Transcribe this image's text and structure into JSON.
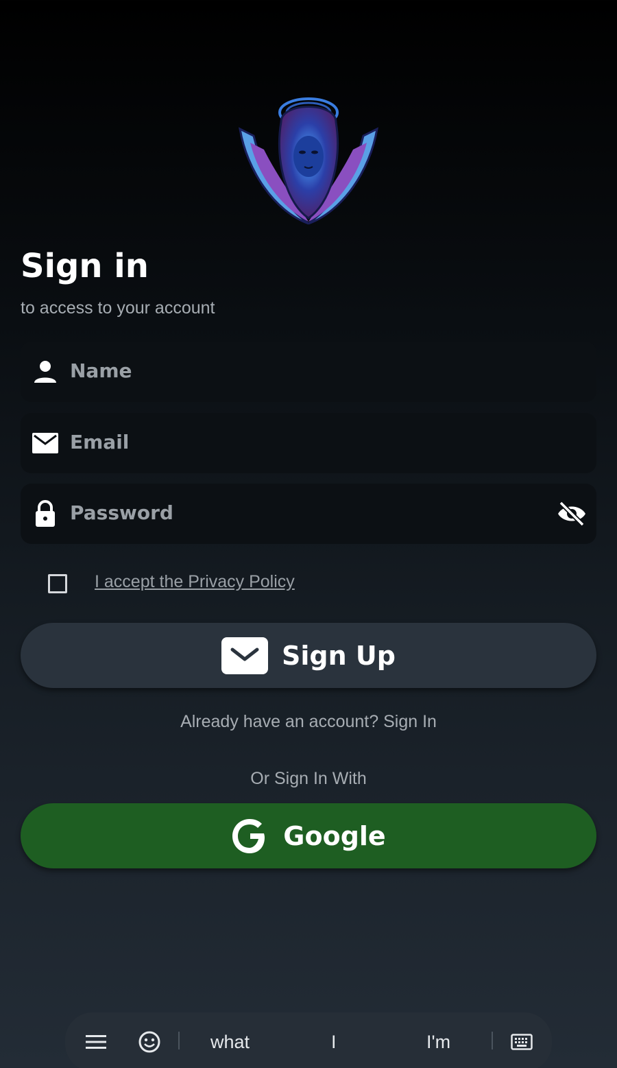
{
  "header": {
    "title": "Sign in",
    "subtitle": "to access to your account"
  },
  "form": {
    "name_placeholder": "Name",
    "email_placeholder": "Email",
    "password_placeholder": "Password",
    "policy_label": "I accept the Privacy Policy",
    "policy_checked": false
  },
  "actions": {
    "signup_label": "Sign Up",
    "already_account": "Already have an account? Sign In",
    "or_sign_in_with": "Or Sign In With",
    "google_label": "Google"
  },
  "keyboard": {
    "suggestions": [
      "what",
      "I",
      "I'm"
    ]
  },
  "icons": {
    "name": "person-icon",
    "email": "mail-icon",
    "password": "lock-icon",
    "visibility": "eye-off-icon",
    "signup": "mail-icon",
    "google": "google-icon"
  },
  "colors": {
    "google_button": "#1e5e22",
    "signup_button": "#2a333d",
    "field_background": "#0c1014"
  }
}
